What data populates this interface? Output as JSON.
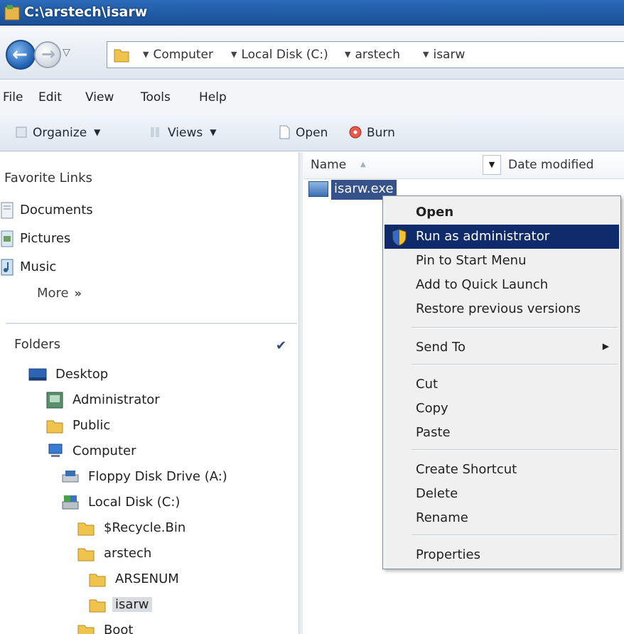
{
  "window": {
    "title": "C:\\arstech\\isarw"
  },
  "address": {
    "breadcrumbs": [
      "Computer",
      "Local Disk (C:)",
      "arstech",
      "isarw"
    ]
  },
  "menu": [
    "File",
    "Edit",
    "View",
    "Tools",
    "Help"
  ],
  "toolbar": {
    "organize": "Organize",
    "views": "Views",
    "open": "Open",
    "burn": "Burn"
  },
  "favorites": {
    "title": "Favorite Links",
    "items": [
      "Documents",
      "Pictures",
      "Music"
    ],
    "more": "More",
    "more_glyph": "»"
  },
  "folders": {
    "title": "Folders",
    "tree": [
      "Desktop",
      "Administrator",
      "Public",
      "Computer",
      "Floppy Disk Drive (A:)",
      "Local Disk (C:)",
      "$Recycle.Bin",
      "arstech",
      "ARSENUM",
      "isarw",
      "Boot"
    ]
  },
  "columns": {
    "name": "Name",
    "date": "Date modified"
  },
  "file": {
    "name": "isarw.exe"
  },
  "context_menu": {
    "open": "Open",
    "run_as_admin": "Run as administrator",
    "pin_start": "Pin to Start Menu",
    "quick_launch": "Add to Quick Launch",
    "restore": "Restore previous versions",
    "send_to": "Send To",
    "cut": "Cut",
    "copy": "Copy",
    "paste": "Paste",
    "create_shortcut": "Create Shortcut",
    "delete": "Delete",
    "rename": "Rename",
    "properties": "Properties"
  },
  "icons": {
    "back": "back-arrow-icon",
    "forward": "forward-arrow-icon",
    "folder": "folder-icon",
    "shield": "uac-shield-icon"
  }
}
